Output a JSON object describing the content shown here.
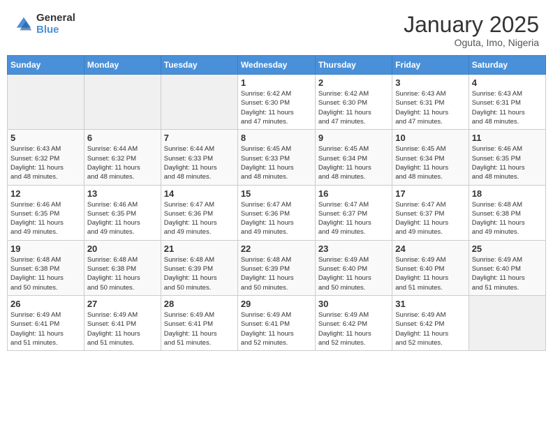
{
  "logo": {
    "general": "General",
    "blue": "Blue"
  },
  "title": "January 2025",
  "subtitle": "Oguta, Imo, Nigeria",
  "days_header": [
    "Sunday",
    "Monday",
    "Tuesday",
    "Wednesday",
    "Thursday",
    "Friday",
    "Saturday"
  ],
  "weeks": [
    [
      {
        "num": "",
        "info": ""
      },
      {
        "num": "",
        "info": ""
      },
      {
        "num": "",
        "info": ""
      },
      {
        "num": "1",
        "info": "Sunrise: 6:42 AM\nSunset: 6:30 PM\nDaylight: 11 hours\nand 47 minutes."
      },
      {
        "num": "2",
        "info": "Sunrise: 6:42 AM\nSunset: 6:30 PM\nDaylight: 11 hours\nand 47 minutes."
      },
      {
        "num": "3",
        "info": "Sunrise: 6:43 AM\nSunset: 6:31 PM\nDaylight: 11 hours\nand 47 minutes."
      },
      {
        "num": "4",
        "info": "Sunrise: 6:43 AM\nSunset: 6:31 PM\nDaylight: 11 hours\nand 48 minutes."
      }
    ],
    [
      {
        "num": "5",
        "info": "Sunrise: 6:43 AM\nSunset: 6:32 PM\nDaylight: 11 hours\nand 48 minutes."
      },
      {
        "num": "6",
        "info": "Sunrise: 6:44 AM\nSunset: 6:32 PM\nDaylight: 11 hours\nand 48 minutes."
      },
      {
        "num": "7",
        "info": "Sunrise: 6:44 AM\nSunset: 6:33 PM\nDaylight: 11 hours\nand 48 minutes."
      },
      {
        "num": "8",
        "info": "Sunrise: 6:45 AM\nSunset: 6:33 PM\nDaylight: 11 hours\nand 48 minutes."
      },
      {
        "num": "9",
        "info": "Sunrise: 6:45 AM\nSunset: 6:34 PM\nDaylight: 11 hours\nand 48 minutes."
      },
      {
        "num": "10",
        "info": "Sunrise: 6:45 AM\nSunset: 6:34 PM\nDaylight: 11 hours\nand 48 minutes."
      },
      {
        "num": "11",
        "info": "Sunrise: 6:46 AM\nSunset: 6:35 PM\nDaylight: 11 hours\nand 48 minutes."
      }
    ],
    [
      {
        "num": "12",
        "info": "Sunrise: 6:46 AM\nSunset: 6:35 PM\nDaylight: 11 hours\nand 49 minutes."
      },
      {
        "num": "13",
        "info": "Sunrise: 6:46 AM\nSunset: 6:35 PM\nDaylight: 11 hours\nand 49 minutes."
      },
      {
        "num": "14",
        "info": "Sunrise: 6:47 AM\nSunset: 6:36 PM\nDaylight: 11 hours\nand 49 minutes."
      },
      {
        "num": "15",
        "info": "Sunrise: 6:47 AM\nSunset: 6:36 PM\nDaylight: 11 hours\nand 49 minutes."
      },
      {
        "num": "16",
        "info": "Sunrise: 6:47 AM\nSunset: 6:37 PM\nDaylight: 11 hours\nand 49 minutes."
      },
      {
        "num": "17",
        "info": "Sunrise: 6:47 AM\nSunset: 6:37 PM\nDaylight: 11 hours\nand 49 minutes."
      },
      {
        "num": "18",
        "info": "Sunrise: 6:48 AM\nSunset: 6:38 PM\nDaylight: 11 hours\nand 49 minutes."
      }
    ],
    [
      {
        "num": "19",
        "info": "Sunrise: 6:48 AM\nSunset: 6:38 PM\nDaylight: 11 hours\nand 50 minutes."
      },
      {
        "num": "20",
        "info": "Sunrise: 6:48 AM\nSunset: 6:38 PM\nDaylight: 11 hours\nand 50 minutes."
      },
      {
        "num": "21",
        "info": "Sunrise: 6:48 AM\nSunset: 6:39 PM\nDaylight: 11 hours\nand 50 minutes."
      },
      {
        "num": "22",
        "info": "Sunrise: 6:48 AM\nSunset: 6:39 PM\nDaylight: 11 hours\nand 50 minutes."
      },
      {
        "num": "23",
        "info": "Sunrise: 6:49 AM\nSunset: 6:40 PM\nDaylight: 11 hours\nand 50 minutes."
      },
      {
        "num": "24",
        "info": "Sunrise: 6:49 AM\nSunset: 6:40 PM\nDaylight: 11 hours\nand 51 minutes."
      },
      {
        "num": "25",
        "info": "Sunrise: 6:49 AM\nSunset: 6:40 PM\nDaylight: 11 hours\nand 51 minutes."
      }
    ],
    [
      {
        "num": "26",
        "info": "Sunrise: 6:49 AM\nSunset: 6:41 PM\nDaylight: 11 hours\nand 51 minutes."
      },
      {
        "num": "27",
        "info": "Sunrise: 6:49 AM\nSunset: 6:41 PM\nDaylight: 11 hours\nand 51 minutes."
      },
      {
        "num": "28",
        "info": "Sunrise: 6:49 AM\nSunset: 6:41 PM\nDaylight: 11 hours\nand 51 minutes."
      },
      {
        "num": "29",
        "info": "Sunrise: 6:49 AM\nSunset: 6:41 PM\nDaylight: 11 hours\nand 52 minutes."
      },
      {
        "num": "30",
        "info": "Sunrise: 6:49 AM\nSunset: 6:42 PM\nDaylight: 11 hours\nand 52 minutes."
      },
      {
        "num": "31",
        "info": "Sunrise: 6:49 AM\nSunset: 6:42 PM\nDaylight: 11 hours\nand 52 minutes."
      },
      {
        "num": "",
        "info": ""
      }
    ]
  ]
}
